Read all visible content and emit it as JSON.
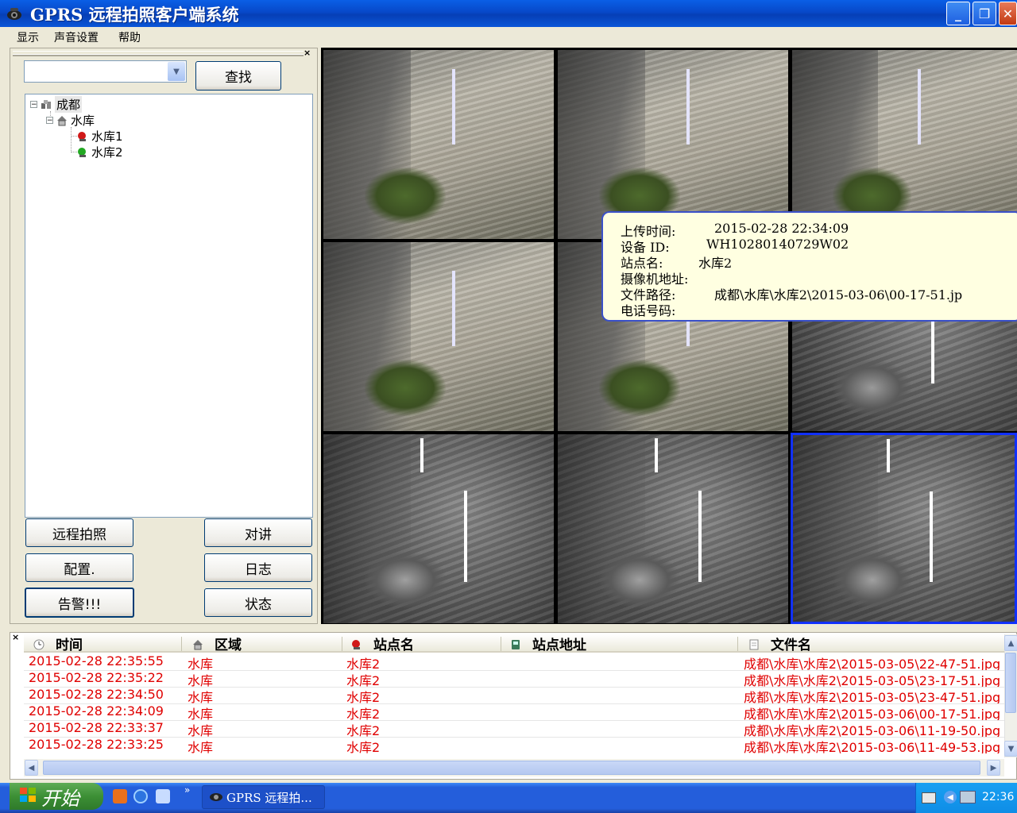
{
  "window": {
    "title": "GPRS 远程拍照客户端系统",
    "controls": {
      "minimize": "_",
      "maximize": "❐",
      "close": "✕"
    }
  },
  "menu": {
    "items": [
      "显示",
      "声音设置",
      "帮助"
    ]
  },
  "left_panel": {
    "close": "×",
    "search_input_value": "",
    "search_button": "查找",
    "tree": {
      "root": "成都",
      "group": "水库",
      "stations": [
        "水库1",
        "水库2"
      ]
    },
    "buttons": {
      "remote_photo": "远程拍照",
      "intercom": "对讲",
      "config": "配置.",
      "log": "日志",
      "alarm": "告警!!!",
      "status": "状态"
    }
  },
  "tooltip": {
    "upload_time_label": "上传时间:",
    "upload_time": "2015-02-28 22:34:09",
    "device_id_label": "设备 ID:",
    "device_id": "WH10280140729W02",
    "station_label": "站点名:",
    "station": "水库2",
    "camera_addr_label": "摄像机地址:",
    "file_path_label": "文件路径:",
    "file_path": "成都\\水库\\水库2\\2015-03-06\\00-17-51.jp",
    "phone_label": "电话号码:"
  },
  "log": {
    "close": "×",
    "columns": [
      "时间",
      "区域",
      "站点名",
      "站点地址",
      "文件名"
    ],
    "rows": [
      [
        "2015-02-28 22:35:55",
        "水库",
        "水库2",
        "",
        "成都\\水库\\水库2\\2015-03-05\\22-47-51.jpg"
      ],
      [
        "2015-02-28 22:35:22",
        "水库",
        "水库2",
        "",
        "成都\\水库\\水库2\\2015-03-05\\23-17-51.jpg"
      ],
      [
        "2015-02-28 22:34:50",
        "水库",
        "水库2",
        "",
        "成都\\水库\\水库2\\2015-03-05\\23-47-51.jpg"
      ],
      [
        "2015-02-28 22:34:09",
        "水库",
        "水库2",
        "",
        "成都\\水库\\水库2\\2015-03-06\\00-17-51.jpg"
      ],
      [
        "2015-02-28 22:33:37",
        "水库",
        "水库2",
        "",
        "成都\\水库\\水库2\\2015-03-06\\11-19-50.jpg"
      ],
      [
        "2015-02-28 22:33:25",
        "水库",
        "水库2",
        "",
        "成都\\水库\\水库2\\2015-03-06\\11-49-53.jpg"
      ]
    ],
    "row_color": "#e00000"
  },
  "taskbar": {
    "start": "开始",
    "task_item": "GPRS 远程拍...",
    "clock": "22:36",
    "quicklaunch_more": "»"
  },
  "colors": {
    "titlebar": "#0a55d8",
    "selection_frame": "#1030ff",
    "tooltip_bg": "#ffffe1"
  }
}
